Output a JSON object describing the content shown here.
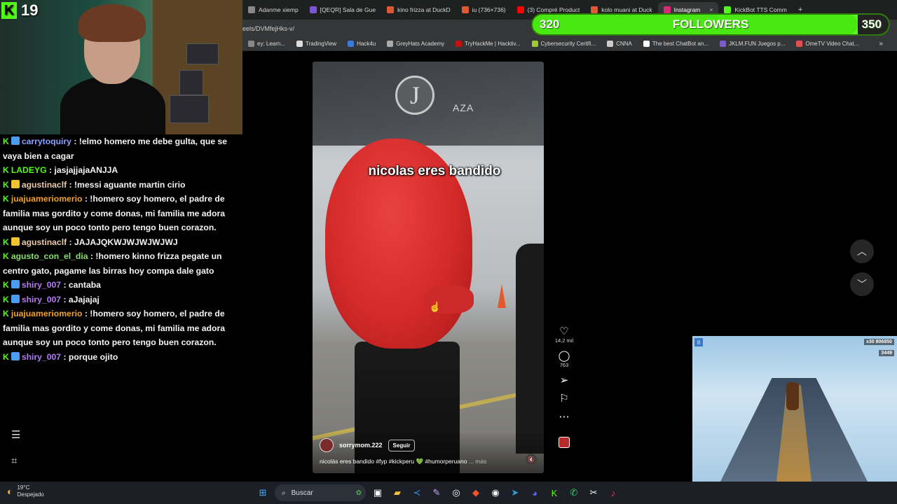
{
  "browser": {
    "tabs": [
      {
        "label": "Adanme xiemp",
        "color": "#888888",
        "active": false
      },
      {
        "label": "[QEQR] Sala de Gue",
        "color": "#7b56d6",
        "active": false
      },
      {
        "label": "kino frizza at DuckD",
        "color": "#de5833",
        "active": false
      },
      {
        "label": "iu (736×736)",
        "color": "#de5833",
        "active": false
      },
      {
        "label": "(3) Compré Product",
        "color": "#ff0000",
        "active": false
      },
      {
        "label": "kolo muani at Duck",
        "color": "#de5833",
        "active": false
      },
      {
        "label": "Instagram",
        "color": "#d62976",
        "active": true
      },
      {
        "label": "KickBot TTS Comm",
        "color": "#53fc18",
        "active": false
      }
    ],
    "url": "eels/DVMfejHks-v/",
    "bookmarks": [
      {
        "label": "ey: Learn...",
        "color": "#888888"
      },
      {
        "label": "TradingView",
        "color": "#dddddd"
      },
      {
        "label": "Hack4u",
        "color": "#3a7bd5"
      },
      {
        "label": "GreyHats Academy",
        "color": "#aaaaaa"
      },
      {
        "label": "TryHackMe | Hacktiv...",
        "color": "#c11111"
      },
      {
        "label": "Cybersecurity Certifi...",
        "color": "#9acd32"
      },
      {
        "label": "CNNA",
        "color": "#cccccc"
      },
      {
        "label": "The best ChatBot an...",
        "color": "#ffffff"
      },
      {
        "label": "JKLM.FUN Juegos p...",
        "color": "#7a5bd0"
      },
      {
        "label": "OmeTV Video Chat...",
        "color": "#e05050"
      }
    ],
    "bookmarks_more": "»",
    "new_tab": "+",
    "close_tab": "×"
  },
  "stream": {
    "viewer_count": "19",
    "kick_glyph": "K",
    "followers": {
      "current": "320",
      "label": "FOLLOWERS",
      "goal": "350",
      "progress": 0.914
    }
  },
  "chat": [
    {
      "user": "carrytoquiry",
      "user_color": "#8aa0ff",
      "badge": "#4a9cf0",
      "text": ": !elmo homero me debe gulta, que se vaya bien a cagar"
    },
    {
      "user": "LADEYG",
      "user_color": "#53fc18",
      "badge": "",
      "text": ": jasjajjajaANJJA"
    },
    {
      "user": "agustinaclf",
      "user_color": "#e8c9a8",
      "badge": "#f1c232",
      "text": ": !messi aguante martin cirio"
    },
    {
      "user": "juajuameriomerio",
      "user_color": "#f0a030",
      "badge": "",
      "text": ": !homero soy homero, el padre de familia mas gordito y come donas, mi familia me adora aunque soy un poco tonto pero tengo buen corazon."
    },
    {
      "user": "agustinaclf",
      "user_color": "#e8c9a8",
      "badge": "#f1c232",
      "text": ": JAJAJQKWJWJWJWJWJ"
    },
    {
      "user": "agusto_con_el_dia",
      "user_color": "#88e06a",
      "badge": "",
      "text": ": !homero kinno frizza pegate un centro gato, pagame las birras hoy compa dale gato"
    },
    {
      "user": "shiry_007",
      "user_color": "#b07cf0",
      "badge": "#4a9cf0",
      "text": ": cantaba"
    },
    {
      "user": "shiry_007",
      "user_color": "#b07cf0",
      "badge": "#4a9cf0",
      "text": ": aJajajaj"
    },
    {
      "user": "juajuameriomerio",
      "user_color": "#f0a030",
      "badge": "",
      "text": ": !homero soy homero, el padre de familia mas gordito y come donas, mi familia me adora aunque soy un poco tonto pero tengo buen corazon."
    },
    {
      "user": "shiry_007",
      "user_color": "#b07cf0",
      "badge": "#4a9cf0",
      "text": ": porque ojito"
    }
  ],
  "reel": {
    "overlay_text": "nicolas eres bandido",
    "author": "sorrymom.222",
    "follow_label": "Seguir",
    "description": "nicolás eres bandido #fyp #kickperu 💚 #humorperuano",
    "more_label": "... más",
    "logo_letter": "J",
    "sign_text": "AZA",
    "likes": "14,2 mil",
    "comments": "763",
    "icons": {
      "like": "heart-icon",
      "comment": "comment-icon",
      "share": "send-icon",
      "save": "bookmark-icon",
      "more": "more-icon"
    }
  },
  "game": {
    "score": "806850",
    "coins": "3449",
    "multiplier": "x30"
  },
  "taskbar": {
    "temperature": "19°C",
    "condition": "Despejado",
    "search_placeholder": "Buscar"
  }
}
